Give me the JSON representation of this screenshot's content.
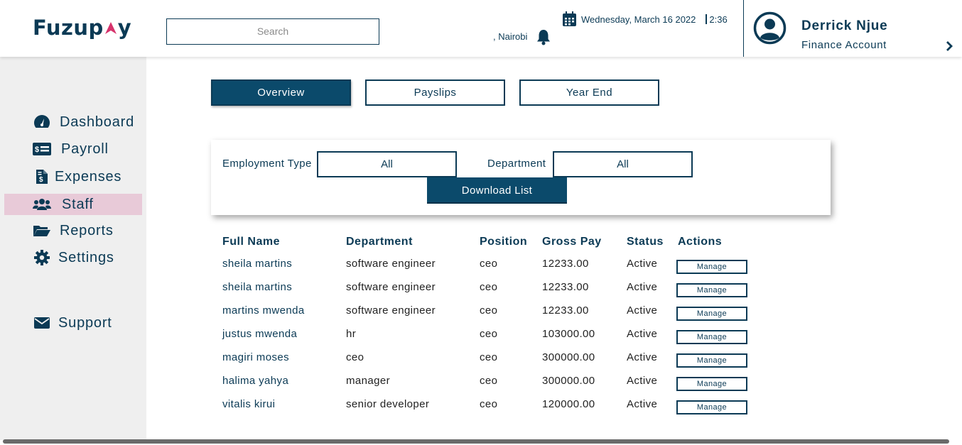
{
  "brand": {
    "logo_text": "Fuzup",
    "logo_accent": "a",
    "logo_tail": "y",
    "accent_color": "#d6336c",
    "primary_color": "#0b3a55"
  },
  "header": {
    "search_placeholder": "Search",
    "date": "Wednesday, March 16 2022",
    "time": "2:36",
    "location": ", Nairobi",
    "user_name": "Derrick Njue",
    "user_role": "Finance  Account"
  },
  "sidebar": {
    "items": [
      {
        "label": "Dashboard",
        "icon": "gauge-icon"
      },
      {
        "label": "Payroll",
        "icon": "money-bill-icon"
      },
      {
        "label": "Expenses",
        "icon": "invoice-dollar-icon"
      },
      {
        "label": "Staff",
        "icon": "users-icon",
        "active": true
      },
      {
        "label": "Reports",
        "icon": "folder-open-icon"
      },
      {
        "label": "Settings",
        "icon": "gear-icon"
      },
      {
        "label": "Support",
        "icon": "envelope-icon"
      }
    ]
  },
  "tabs": [
    {
      "label": "Overview",
      "active": true
    },
    {
      "label": "Payslips"
    },
    {
      "label": "Year End"
    }
  ],
  "filters": {
    "employment_type_label": "Employment Type",
    "employment_type_value": "All",
    "department_label": "Department",
    "department_value": "All",
    "download_label": "Download List"
  },
  "table": {
    "headers": [
      "Full Name",
      "Department",
      "Position",
      "Gross Pay",
      "Status",
      "Actions"
    ],
    "manage_label": "Manage",
    "rows": [
      {
        "name": "sheila martins",
        "department": "software engineer",
        "position": "ceo",
        "gross_pay": "12233.00",
        "status": "Active"
      },
      {
        "name": "sheila martins",
        "department": "software engineer",
        "position": "ceo",
        "gross_pay": "12233.00",
        "status": "Active"
      },
      {
        "name": "martins mwenda",
        "department": "software engineer",
        "position": "ceo",
        "gross_pay": "12233.00",
        "status": "Active"
      },
      {
        "name": "justus mwenda",
        "department": "hr",
        "position": "ceo",
        "gross_pay": "103000.00",
        "status": "Active"
      },
      {
        "name": "magiri moses",
        "department": "ceo",
        "position": "ceo",
        "gross_pay": "300000.00",
        "status": "Active"
      },
      {
        "name": "halima yahya",
        "department": "manager",
        "position": "ceo",
        "gross_pay": "300000.00",
        "status": "Active"
      },
      {
        "name": "vitalis kirui",
        "department": "senior developer",
        "position": "ceo",
        "gross_pay": "120000.00",
        "status": "Active"
      }
    ]
  }
}
